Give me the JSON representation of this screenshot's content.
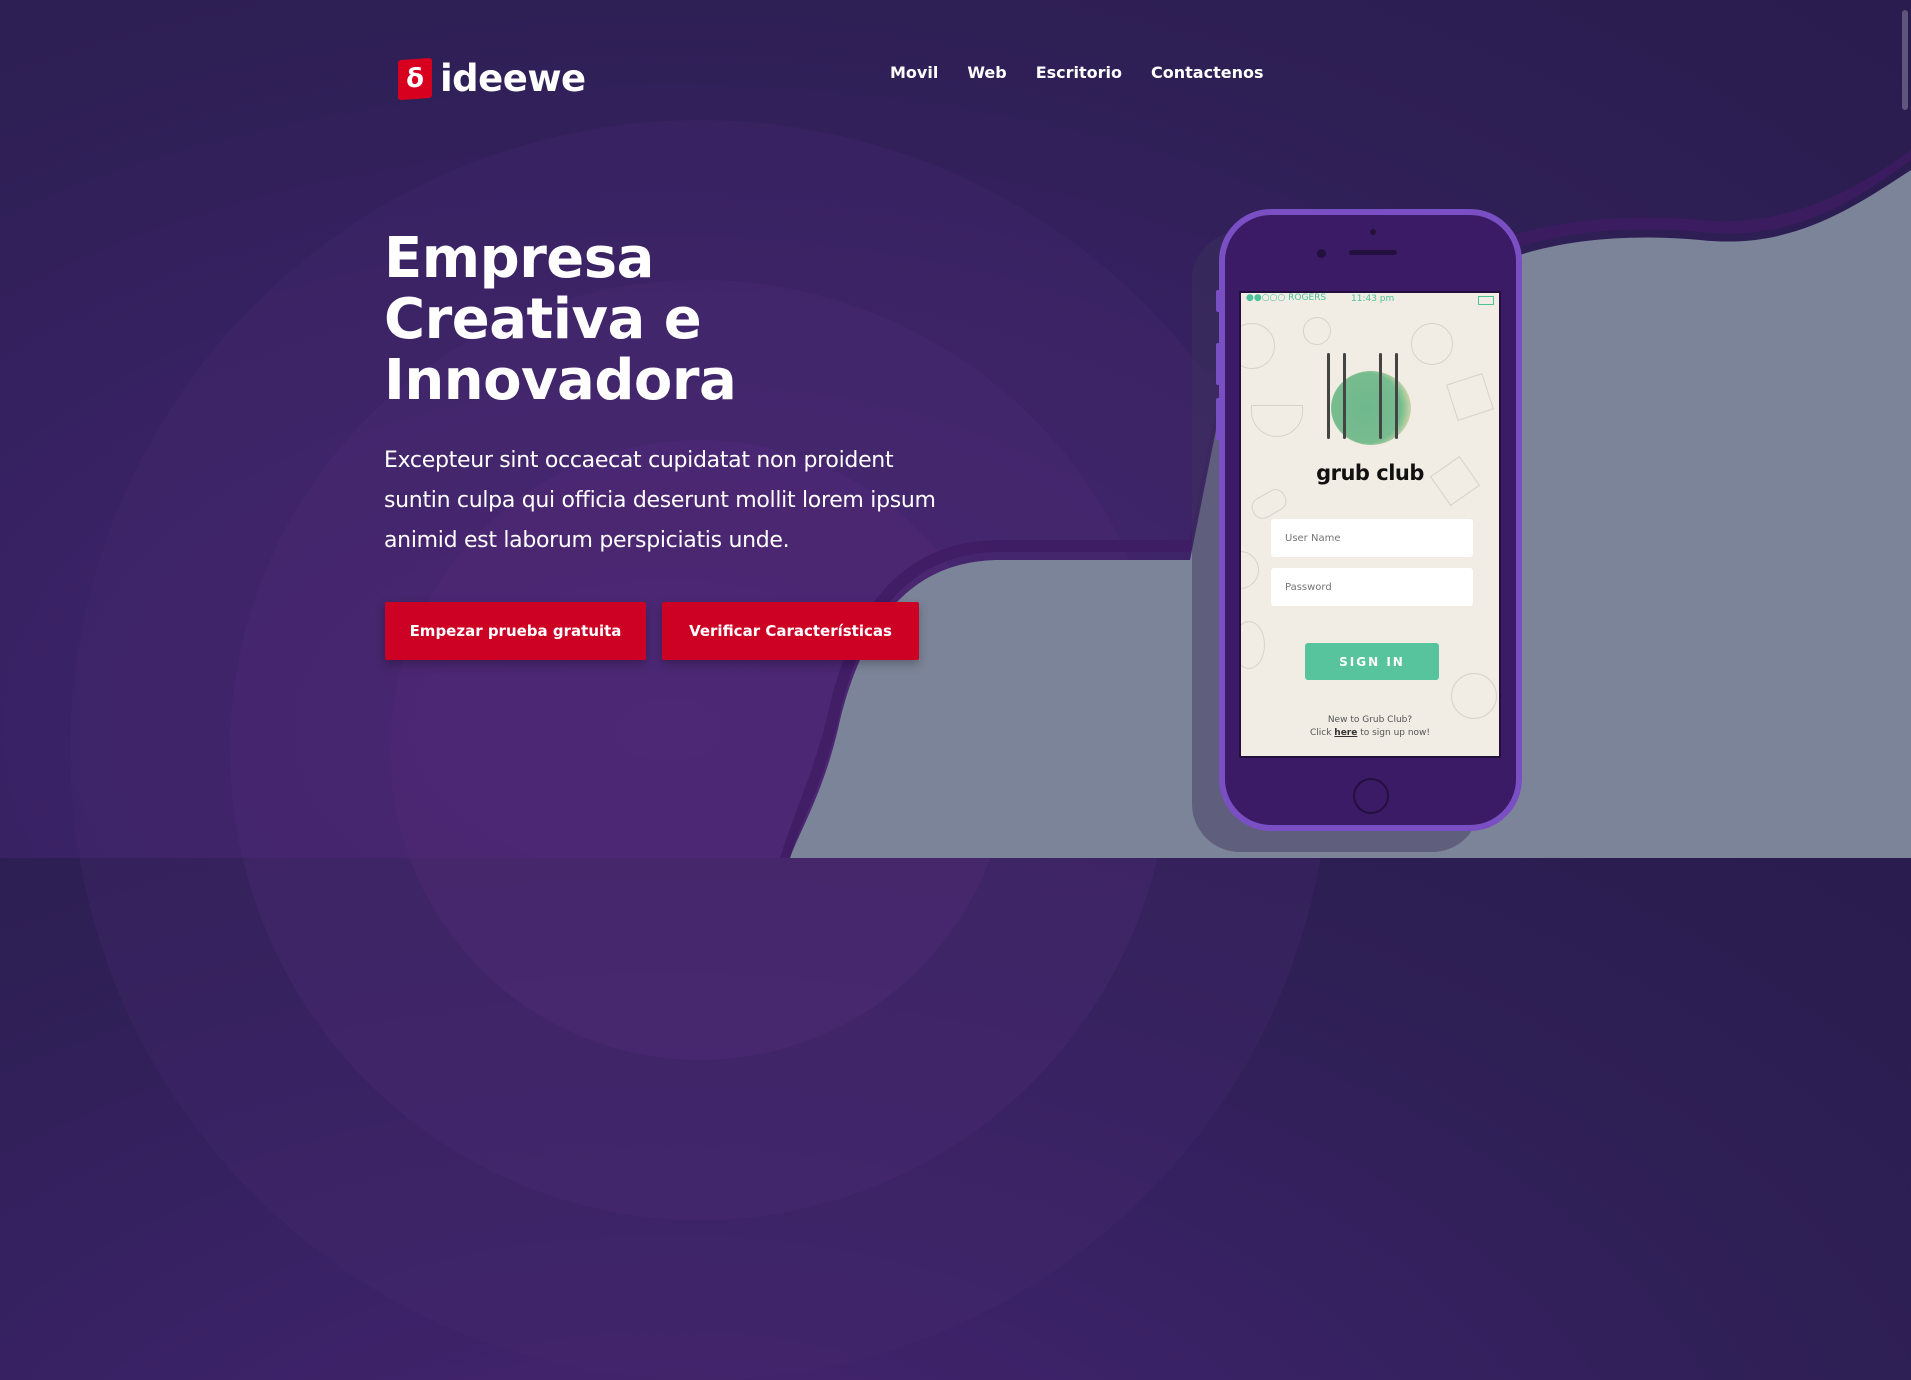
{
  "brand": {
    "name": "ideewe",
    "logo_glyph": "δ",
    "logo_color": "#d8001f"
  },
  "nav": {
    "items": [
      "Movil",
      "Web",
      "Escritorio",
      "Contactenos"
    ]
  },
  "hero": {
    "headline": "Empresa Creativa e Innovadora",
    "lead": "Excepteur sint occaecat cupidatat non proident suntin culpa qui officia deserunt mollit lorem ipsum animid est laborum perspiciatis unde.",
    "primary_button": "Empezar prueba gratuita",
    "secondary_button": "Verificar Características",
    "button_color": "#cc0123"
  },
  "phone_app": {
    "status_carrier": "●●○○○ ROGERS",
    "status_time": "11:43 pm",
    "app_name": "grub club",
    "username_placeholder": "User Name",
    "password_placeholder": "Password",
    "signin_label": "SIGN IN",
    "signup_line1": "New to Grub Club?",
    "signup_prefix": "Click ",
    "signup_link": "here",
    "signup_suffix": " to sign up now!",
    "accent_color": "#58c49d"
  },
  "colors": {
    "background": "#2e1f55",
    "wave": "#7c8499",
    "phone_frame": "#7b4fc4"
  }
}
